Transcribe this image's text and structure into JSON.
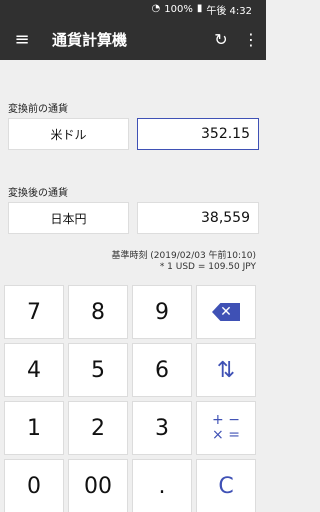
{
  "statusbar": {
    "wifi_icon": "wifi-icon",
    "battery_text": "100%",
    "battery_icon": "battery-icon",
    "time": "午後 4:32"
  },
  "appbar": {
    "menu_icon": "menu-icon",
    "title": "通貨計算機",
    "refresh_icon": "refresh-icon",
    "more_icon": "more-vert-icon"
  },
  "from": {
    "label": "変換前の通貨",
    "currency": "米ドル",
    "amount": "352.15"
  },
  "to": {
    "label": "変換後の通貨",
    "currency": "日本円",
    "amount": "38,559"
  },
  "meta": {
    "base_time": "基準時刻 (2019/02/03 午前10:10)",
    "rate": "* 1 USD = 109.50 JPY"
  },
  "keys": [
    {
      "label": "7"
    },
    {
      "label": "8"
    },
    {
      "label": "9"
    },
    {
      "label": "",
      "icon": "backspace-icon"
    },
    {
      "label": "4"
    },
    {
      "label": "5"
    },
    {
      "label": "6"
    },
    {
      "label": "⇅",
      "icon": "swap-icon"
    },
    {
      "label": "1"
    },
    {
      "label": "2"
    },
    {
      "label": "3"
    },
    {
      "label": "+ −\n× =",
      "icon": "operators-icon"
    },
    {
      "label": "0"
    },
    {
      "label": "00"
    },
    {
      "label": "."
    },
    {
      "label": "C",
      "icon": "clear-icon"
    }
  ]
}
